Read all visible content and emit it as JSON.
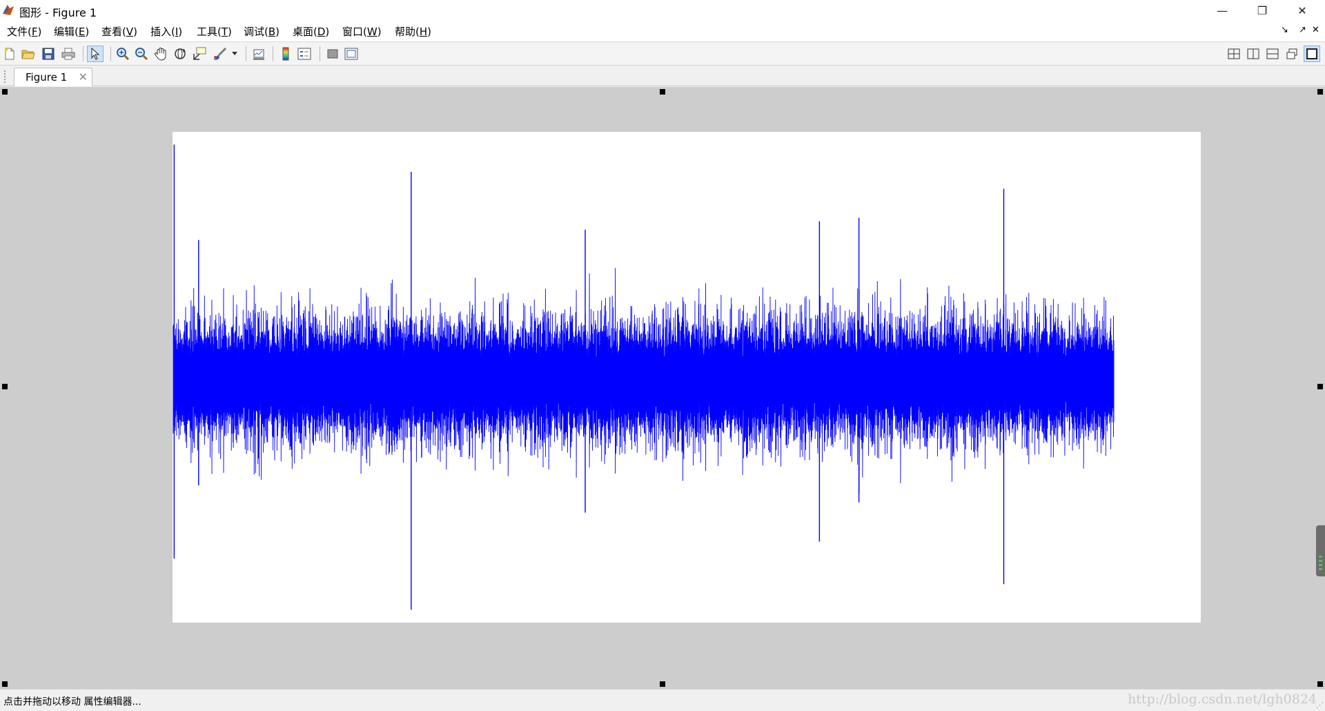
{
  "window": {
    "title": "图形 - Figure 1",
    "controls": {
      "minimize": "—",
      "restore": "❐",
      "close": "✕"
    }
  },
  "menu": {
    "items": [
      {
        "label": "文件(",
        "key": "F",
        "suffix": ")"
      },
      {
        "label": "编辑(",
        "key": "E",
        "suffix": ")"
      },
      {
        "label": "查看(",
        "key": "V",
        "suffix": ")"
      },
      {
        "label": "插入(",
        "key": "I",
        "suffix": ")"
      },
      {
        "label": "工具(",
        "key": "T",
        "suffix": ")"
      },
      {
        "label": "调试(",
        "key": "B",
        "suffix": ")"
      },
      {
        "label": "桌面(",
        "key": "D",
        "suffix": ")"
      },
      {
        "label": "窗口(",
        "key": "W",
        "suffix": ")"
      },
      {
        "label": "帮助(",
        "key": "H",
        "suffix": ")"
      }
    ],
    "dock_controls": [
      "↘",
      "↗",
      "✕"
    ]
  },
  "toolbar": {
    "buttons": [
      "new-figure-icon",
      "open-icon",
      "save-icon",
      "print-icon",
      "edit-plot-icon",
      "zoom-in-icon",
      "zoom-out-icon",
      "pan-icon",
      "rotate-3d-icon",
      "data-cursor-icon",
      "brush-icon",
      "link-plot-icon",
      "colorbar-icon",
      "legend-icon",
      "hide-plot-tools-icon",
      "show-plot-tools-icon"
    ],
    "active": "edit-plot-icon",
    "layout_buttons": [
      "tile-grid-icon",
      "tile-columns-icon",
      "tile-rows-icon",
      "float-icon",
      "maximize-icon"
    ]
  },
  "tabs": [
    {
      "label": "Figure 1",
      "close": "✕"
    }
  ],
  "chart_data": {
    "type": "line",
    "series_color": "#0000ff",
    "description_values": "dense noise signal",
    "n_points": 60000,
    "noise_amplitude": 0.36,
    "spikes": [
      {
        "x": 0.001,
        "y": 1.38
      },
      {
        "x": 0.001,
        "y": -1.05
      },
      {
        "x": 0.027,
        "y": 0.82
      },
      {
        "x": 0.027,
        "y": -0.62
      },
      {
        "x": 0.253,
        "y": 1.22
      },
      {
        "x": 0.253,
        "y": -1.35
      },
      {
        "x": 0.438,
        "y": 0.88
      },
      {
        "x": 0.438,
        "y": -0.78
      },
      {
        "x": 0.687,
        "y": 0.93
      },
      {
        "x": 0.687,
        "y": -0.95
      },
      {
        "x": 0.729,
        "y": 0.95
      },
      {
        "x": 0.729,
        "y": -0.72
      },
      {
        "x": 0.883,
        "y": 1.12
      },
      {
        "x": 0.883,
        "y": -1.2
      }
    ],
    "xlim": [
      0,
      1
    ],
    "ylim": [
      -1.44,
      1.44
    ],
    "grid": false
  },
  "status": {
    "text": "点击并拖动以移动 属性编辑器...",
    "watermark": "http://blog.csdn.net/lgh0824"
  }
}
